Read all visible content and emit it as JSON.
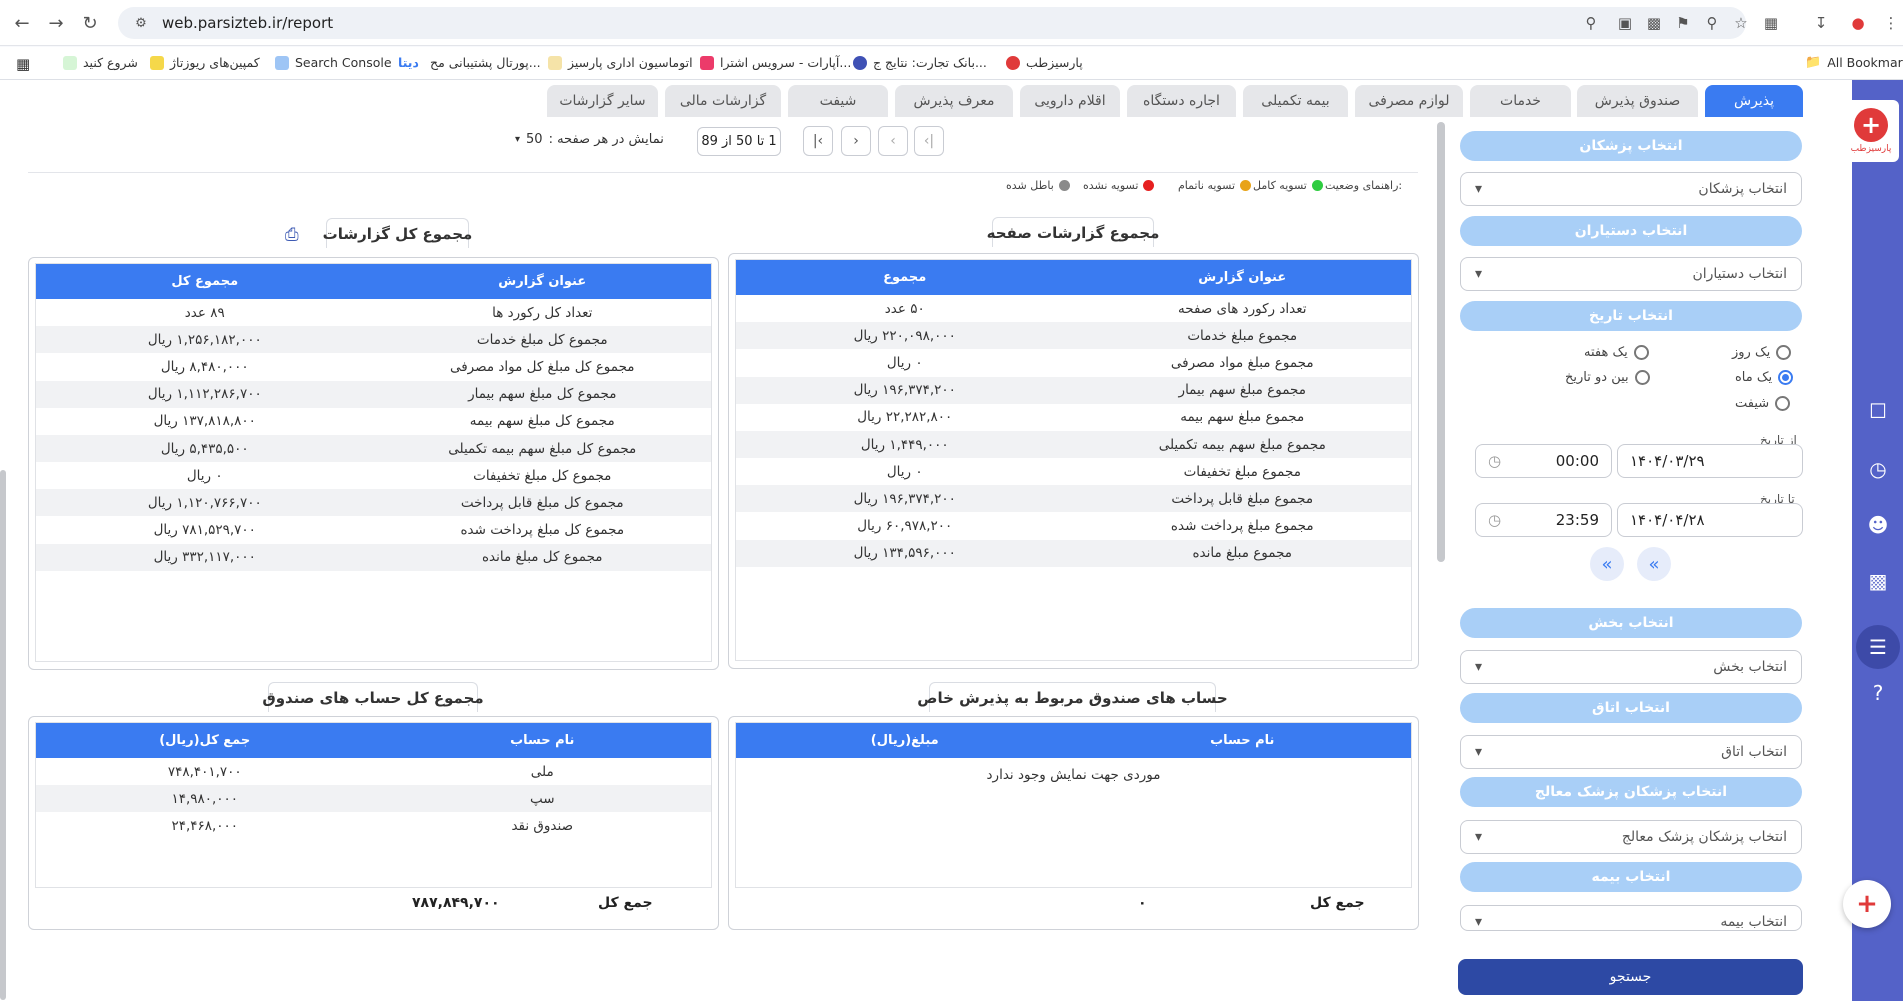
{
  "browser": {
    "url": "web.parsizteb.ir/report",
    "all_bookmarks": "All Bookmarks",
    "bookmarks": [
      "شروع کنید",
      "کمپین‌های ریوزتاژ",
      "Search Console",
      "دیتا",
      "پورتال پشتیبانی مح...",
      "اتوماسیون اداری پارسیز",
      "آپارات - سرویس اشترا...",
      "بانک تجارت: نتایج ج...",
      "پارسیزطب"
    ]
  },
  "app": {
    "logo_text": "پارسیزطب"
  },
  "tabs": [
    "پذیرش",
    "صندوق پذیرش",
    "خدمات",
    "لوازم مصرفی",
    "بیمه تکمیلی",
    "اجاره دستگاه",
    "اقلام دارویی",
    "معرف پذیرش",
    "شیفت",
    "گزارشات مالی",
    "سایر گزارشات"
  ],
  "sidebar": {
    "doctor_btn": "انتخاب پزشکان",
    "doctor_select": "انتخاب پزشکان",
    "assistant_btn": "انتخاب دستیاران",
    "assistant_select": "انتخاب دستیاران",
    "date_btn": "انتخاب تاریخ",
    "radios": {
      "one_day": "یک روز",
      "one_week": "یک هفته",
      "one_month": "یک ماه",
      "between_dates": "بین دو تاریخ",
      "shift": "شیفت"
    },
    "selected_radio": "یک ماه",
    "from_label": "از تاریخ",
    "from_date": "۱۴۰۴/۰۳/۲۹",
    "from_time": "00:00",
    "to_label": "تا تاریخ",
    "to_date": "۱۴۰۴/۰۴/۲۸",
    "to_time": "23:59",
    "section_btn": "انتخاب بخش",
    "section_select": "انتخاب بخش",
    "room_btn": "انتخاب اتاق",
    "room_select": "انتخاب اتاق",
    "treating_btn": "انتخاب پزشکان پزشک معالج",
    "treating_select": "انتخاب پزشکان پزشک معالج",
    "insurance_btn": "انتخاب بیمه",
    "insurance_select": "انتخاب بیمه",
    "search_btn": "جستجو"
  },
  "pager": {
    "per_page_label": "نمایش در هر صفحه :",
    "per_page_value": "50",
    "range_text": "1 تا 50 از 89"
  },
  "legend": {
    "title": "راهنمای وضعیت:",
    "items": [
      {
        "label": "تسویه کامل",
        "color": "#2ecc40"
      },
      {
        "label": "تسویه ناتمام",
        "color": "#e8a317"
      },
      {
        "label": "تسویه نشده",
        "color": "#e62020"
      },
      {
        "label": "باطل شده",
        "color": "#8a8a8a"
      }
    ]
  },
  "page_summary": {
    "title": "مجموع گزارشات صفحه",
    "col_title": "عنوان گزارش",
    "col_value": "مجموع",
    "rows": [
      [
        "تعداد رکورد های صفحه",
        "۵۰ عدد"
      ],
      [
        "مجموع مبلغ خدمات",
        "۲۲۰,۰۹۸,۰۰۰ ریال"
      ],
      [
        "مجموع مبلغ مواد مصرفی",
        "۰ ریال"
      ],
      [
        "مجموع مبلغ سهم بیمار",
        "۱۹۶,۳۷۴,۲۰۰ ریال"
      ],
      [
        "مجموع مبلغ سهم بیمه",
        "۲۲,۲۸۲,۸۰۰ ریال"
      ],
      [
        "مجموع مبلغ سهم بیمه تکمیلی",
        "۱,۴۴۹,۰۰۰ ریال"
      ],
      [
        "مجموع مبلغ تخفیفات",
        "۰ ریال"
      ],
      [
        "مجموع مبلغ قابل پرداخت",
        "۱۹۶,۳۷۴,۲۰۰ ریال"
      ],
      [
        "مجموع مبلغ پرداخت شده",
        "۶۰,۹۷۸,۲۰۰ ریال"
      ],
      [
        "مجموع مبلغ مانده",
        "۱۳۴,۵۹۶,۰۰۰ ریال"
      ]
    ]
  },
  "total_summary": {
    "title": "مجموع کل گزارشات",
    "col_title": "عنوان گزارش",
    "col_value": "مجموع کل",
    "rows": [
      [
        "تعداد کل رکورد ها",
        "۸۹ عدد"
      ],
      [
        "مجموع کل مبلغ خدمات",
        "۱,۲۵۶,۱۸۲,۰۰۰ ریال"
      ],
      [
        "مجموع کل مبلغ کل مواد مصرفی",
        "۸,۴۸۰,۰۰۰ ریال"
      ],
      [
        "مجموع کل مبلغ سهم بیمار",
        "۱,۱۱۲,۲۸۶,۷۰۰ ریال"
      ],
      [
        "مجموع کل مبلغ سهم بیمه",
        "۱۳۷,۸۱۸,۸۰۰ ریال"
      ],
      [
        "مجموع کل مبلغ سهم بیمه تکمیلی",
        "۵,۴۳۵,۵۰۰ ریال"
      ],
      [
        "مجموع کل مبلغ تخفیفات",
        "۰ ریال"
      ],
      [
        "مجموع کل مبلغ قابل پرداخت",
        "۱,۱۲۰,۷۶۶,۷۰۰ ریال"
      ],
      [
        "مجموع کل مبلغ پرداخت شده",
        "۷۸۱,۵۲۹,۷۰۰ ریال"
      ],
      [
        "مجموع کل مبلغ مانده",
        "۳۳۲,۱۱۷,۰۰۰ ریال"
      ]
    ]
  },
  "special_fund": {
    "title": "حساب های صندوق مربوط به پذیرش خاص",
    "col_name": "نام حساب",
    "col_amount": "مبلغ(ریال)",
    "empty": "موردی جهت نمایش وجود ندارد",
    "total_label": "جمع کل",
    "total_value": "۰"
  },
  "all_funds": {
    "title": "مجموع کل حساب های صندوق",
    "col_name": "نام حساب",
    "col_amount": "جمع کل(ریال)",
    "rows": [
      [
        "ملی",
        "۷۴۸,۴۰۱,۷۰۰"
      ],
      [
        "سپ",
        "۱۴,۹۸۰,۰۰۰"
      ],
      [
        "صندوق نقد",
        "۲۴,۴۶۸,۰۰۰"
      ]
    ],
    "total_label": "جمع کل",
    "total_value": "۷۸۷,۸۴۹,۷۰۰"
  }
}
